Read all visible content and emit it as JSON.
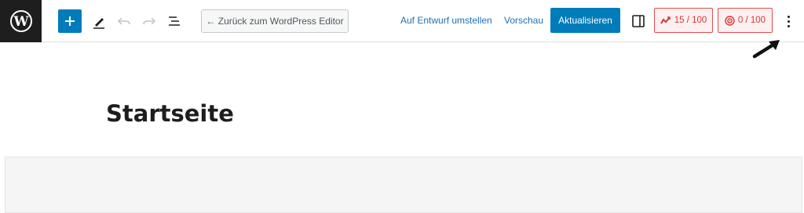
{
  "toolbar": {
    "back_label": "← Zurück zum WordPress Editor",
    "draft_label": "Auf Entwurf umstellen",
    "preview_label": "Vorschau",
    "update_label": "Aktualisieren",
    "seo_score": "15 / 100",
    "readability_score": "0 / 100",
    "icons": [
      "wordpress-logo",
      "plus",
      "pencil",
      "undo",
      "redo",
      "list-view",
      "sidebar-toggle",
      "trend-chart",
      "readability-target",
      "more-vertical"
    ]
  },
  "page": {
    "title": "Startseite"
  },
  "colors": {
    "accent": "#007cba",
    "link": "#2271b1",
    "score_red": "#d63638",
    "logo_bg": "#1e1e1e"
  }
}
